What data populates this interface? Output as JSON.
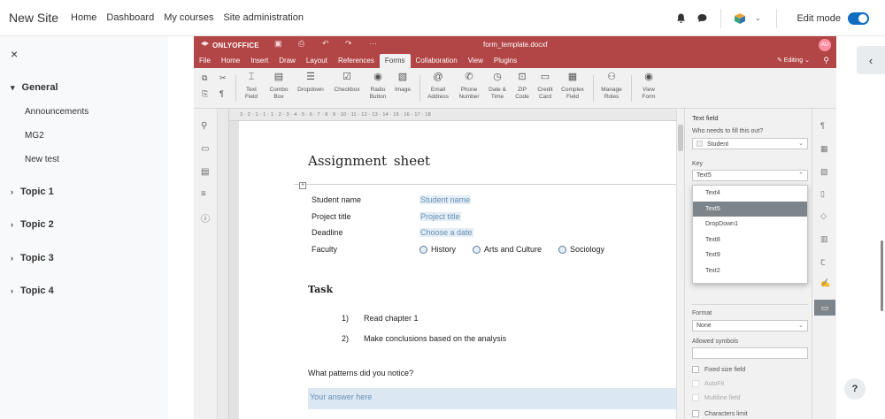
{
  "moodle": {
    "site_name": "New Site",
    "nav": [
      "Home",
      "Dashboard",
      "My courses",
      "Site administration"
    ],
    "edit_mode_label": "Edit mode",
    "edit_mode_on": true
  },
  "course_index": {
    "close_glyph": "×",
    "sections": [
      {
        "title": "General",
        "expanded": true,
        "items": [
          "Announcements",
          "MG2",
          "New test"
        ]
      },
      {
        "title": "Topic 1",
        "expanded": false
      },
      {
        "title": "Topic 2",
        "expanded": false
      },
      {
        "title": "Topic 3",
        "expanded": false
      },
      {
        "title": "Topic 4",
        "expanded": false
      }
    ]
  },
  "editor": {
    "brand": "ONLYOFFICE",
    "file_name": "form_template.docxf",
    "avatar_initials": "AU",
    "menu_tabs": [
      "File",
      "Home",
      "Insert",
      "Draw",
      "Layout",
      "References",
      "Forms",
      "Collaboration",
      "View",
      "Plugins"
    ],
    "active_tab": "Forms",
    "editing_label": "Editing",
    "toolbar": {
      "text_field": "Text Field",
      "combo_box": "Combo Box",
      "dropdown": "Dropdown",
      "checkbox": "Checkbox",
      "radio_button": "Radio Button",
      "image": "Image",
      "email_address": "Email Address",
      "phone_number": "Phone Number",
      "date_time": "Date & Time",
      "zip_code": "ZIP Code",
      "credit_card": "Credit Card",
      "complex_field": "Complex Field",
      "manage_roles": "Manage Roles",
      "view_form": "View Form"
    },
    "ruler_scale": "3 · 2 · 1 · 1 · 1 · 2 · 3 · 4 · 5 · 6 · 7 · 8 · 9 · 10 · 11 · 12 · 13 · 14 · 15 · 16 · 17 · 18"
  },
  "document": {
    "heading": "Assignment  sheet",
    "fields": [
      {
        "label": "Student name",
        "value": "Student name"
      },
      {
        "label": "Project title",
        "value": "Project title"
      },
      {
        "label": "Deadline",
        "value": "Choose a date"
      }
    ],
    "faculty_label": "Faculty",
    "faculty_options": [
      "History",
      "Arts and Culture",
      "Sociology"
    ],
    "task_heading": "Task",
    "tasks": [
      {
        "num": "1)",
        "text": "Read chapter 1"
      },
      {
        "num": "2)",
        "text": "Make conclusions based on the analysis"
      }
    ],
    "question": "What patterns did you notice?",
    "answer_placeholder": "Your answer here"
  },
  "properties": {
    "title": "Text field",
    "who_label": "Who needs to fill this out?",
    "who_value": "Student",
    "key_label": "Key",
    "key_value": "Text5",
    "key_options": [
      "Text4",
      "Text5",
      "DropDown1",
      "Text8",
      "Text9",
      "Text2"
    ],
    "key_selected": "Text5",
    "format_label": "Format",
    "format_value": "None",
    "allowed_symbols_label": "Allowed symbols",
    "fixed_size": "Fixed size field",
    "autofit": "AutoFit",
    "multiline": "Multiline field",
    "char_limit": "Characters limit"
  },
  "colors": {
    "header": "#b24545",
    "accent": "#0f6cbf",
    "form_field_bg": "#e3eef8"
  }
}
